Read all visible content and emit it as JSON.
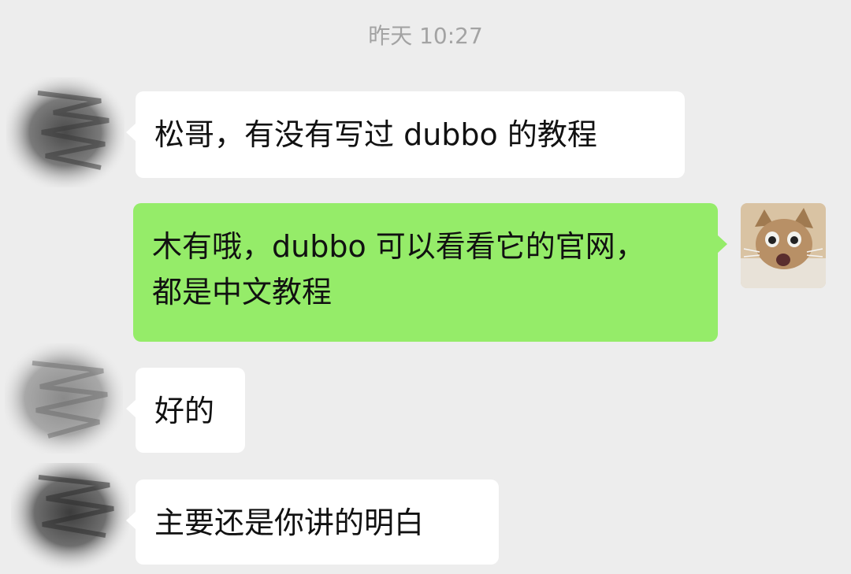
{
  "timestamp": "昨天 10:27",
  "messages": [
    {
      "side": "in",
      "lines": [
        "松哥，有没有写过 dubbo 的教程"
      ]
    },
    {
      "side": "out",
      "lines": [
        "木有哦，dubbo 可以看看它的官网，",
        "都是中文教程"
      ]
    },
    {
      "side": "in",
      "lines": [
        "好的"
      ]
    },
    {
      "side": "in",
      "lines": [
        "主要还是你讲的明白"
      ]
    }
  ],
  "colors": {
    "background": "#ededed",
    "incoming_bubble": "#ffffff",
    "outgoing_bubble": "#95ec69",
    "timestamp_text": "#a3a3a3"
  },
  "icons": {
    "contact_avatar": "scribbled-out-avatar",
    "own_avatar": "cat-photo-avatar"
  }
}
